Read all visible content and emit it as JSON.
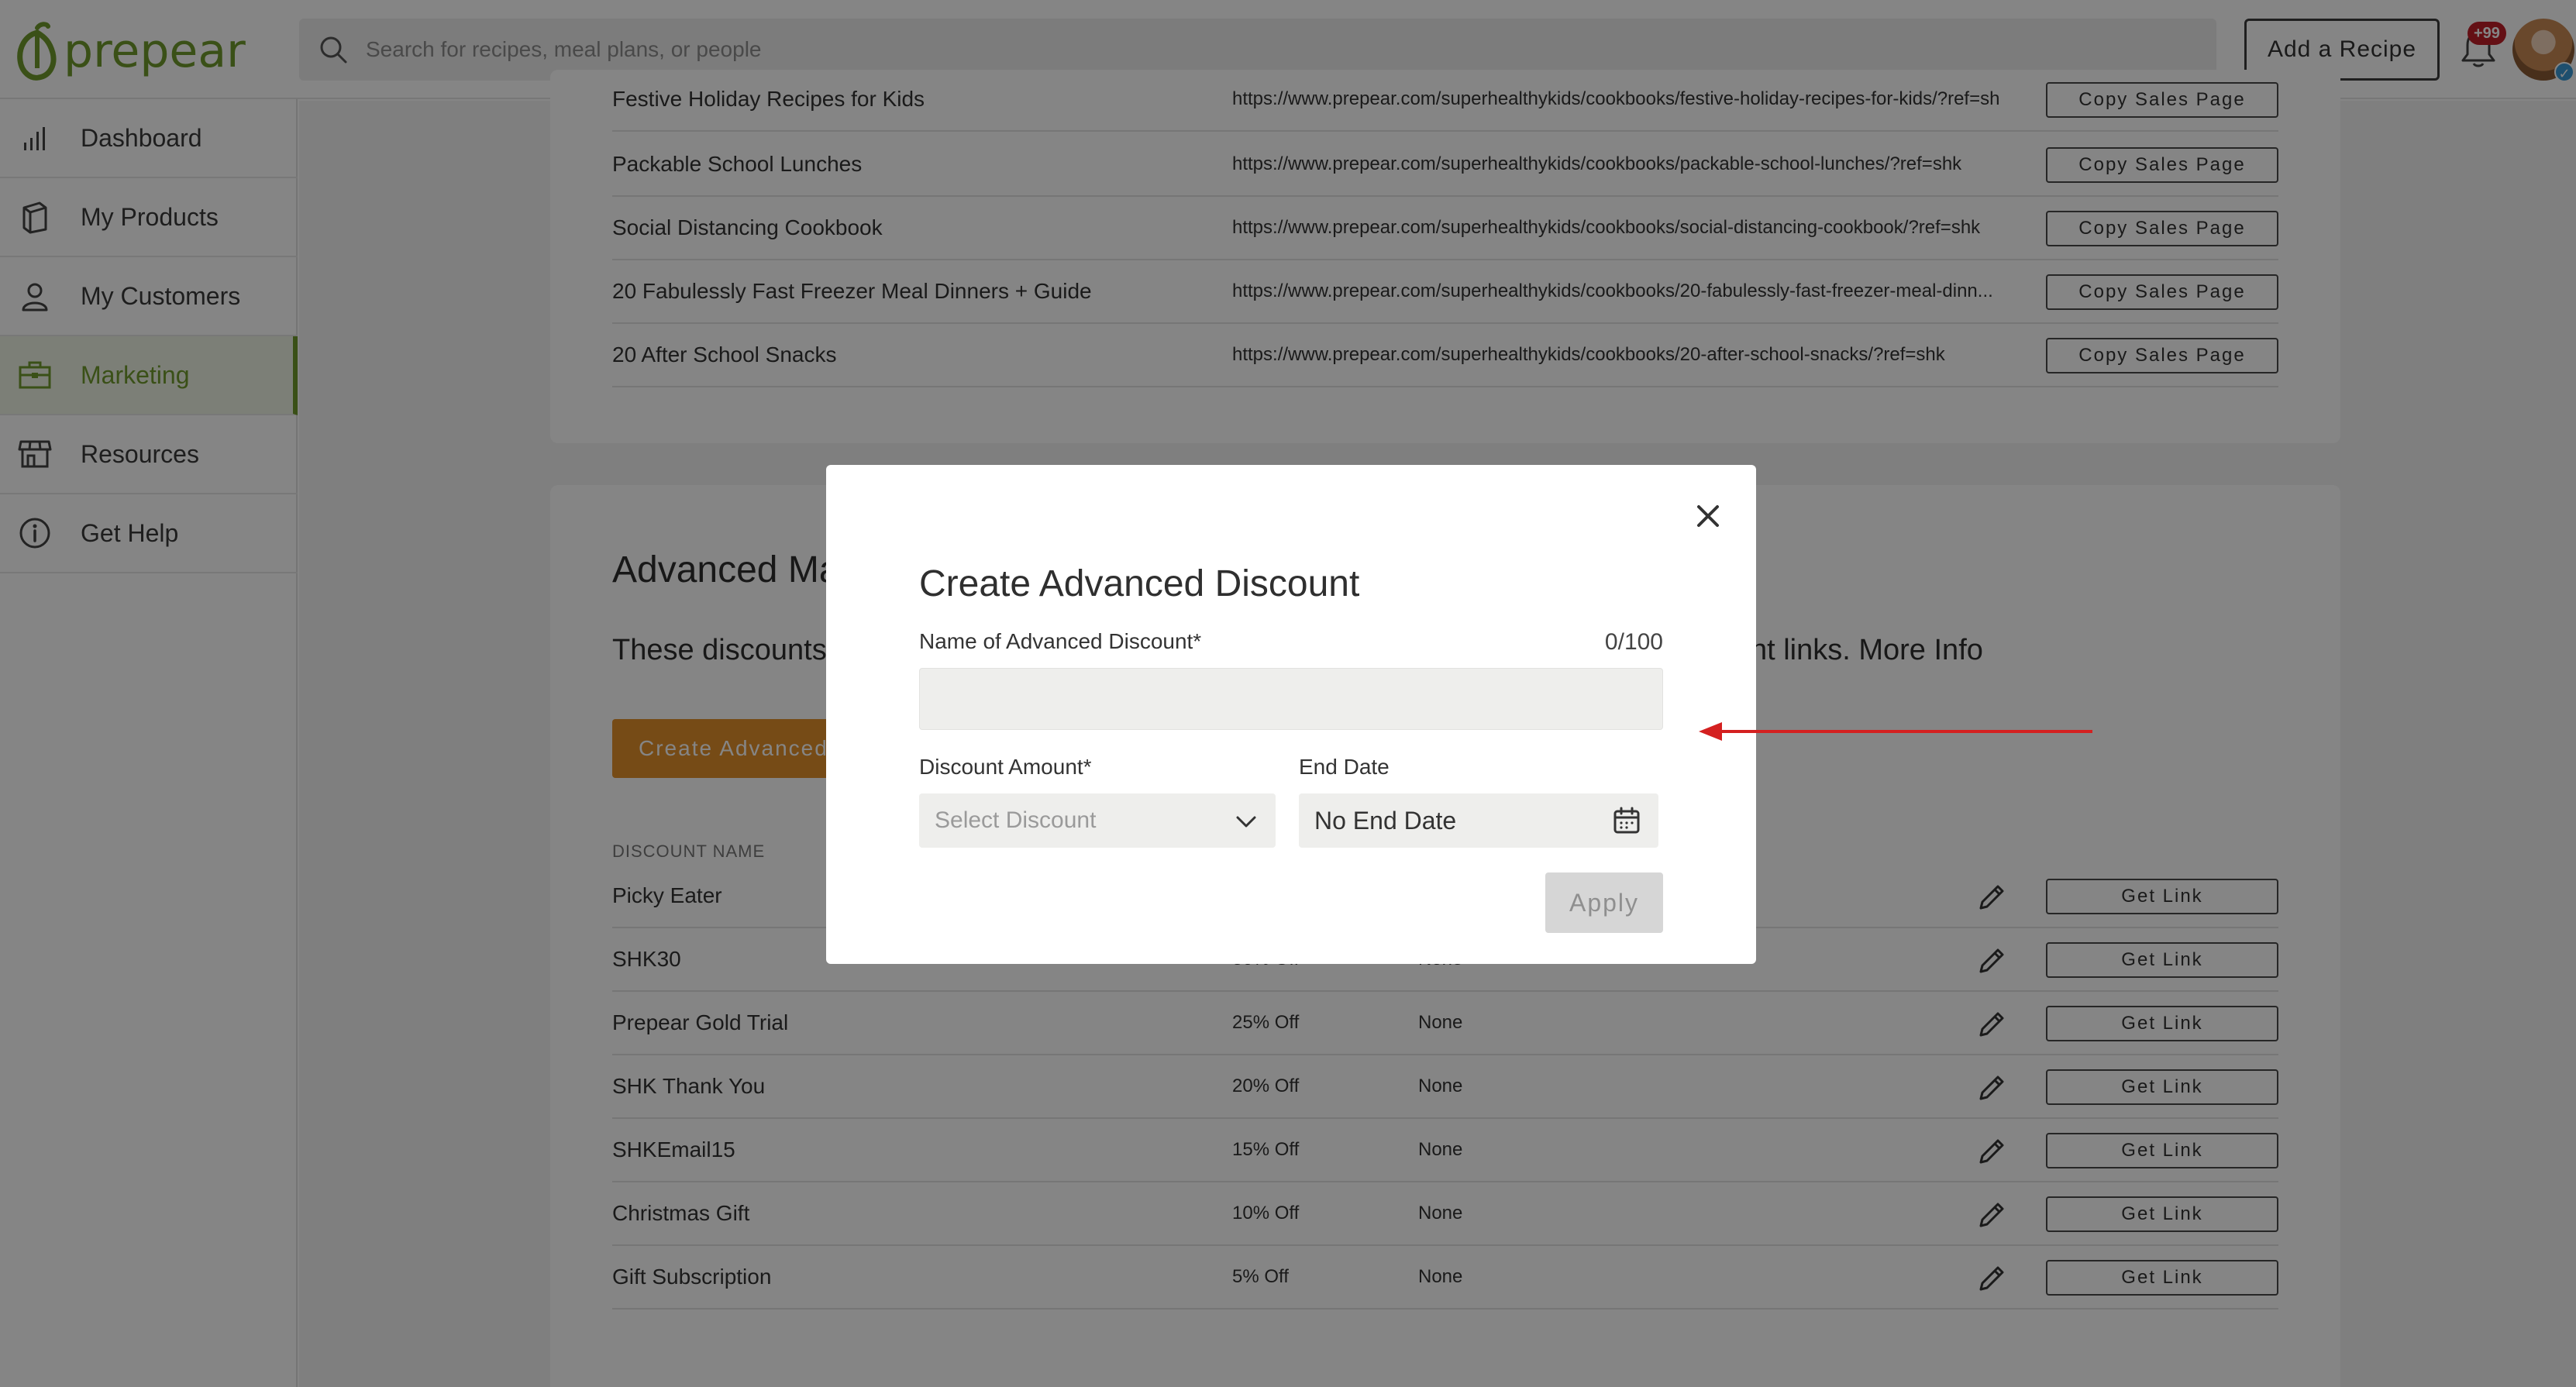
{
  "app": {
    "logo_text": "prepear",
    "brand_color": "#6f9a2c"
  },
  "header": {
    "search_placeholder": "Search for recipes, meal plans, or people",
    "add_recipe_label": "Add a Recipe",
    "notification_count": "+99"
  },
  "sidebar": {
    "items": [
      {
        "label": "Dashboard",
        "icon": "bar-chart-icon"
      },
      {
        "label": "My Products",
        "icon": "box-icon"
      },
      {
        "label": "My Customers",
        "icon": "person-icon"
      },
      {
        "label": "Marketing",
        "icon": "briefcase-icon",
        "active": true
      },
      {
        "label": "Resources",
        "icon": "storefront-icon"
      },
      {
        "label": "Get Help",
        "icon": "info-icon"
      }
    ]
  },
  "sales_pages": {
    "rows": [
      {
        "name": "Festive Holiday Recipes for Kids",
        "url": "https://www.prepear.com/superhealthykids/cookbooks/festive-holiday-recipes-for-kids/?ref=shk",
        "button": "Copy Sales Page"
      },
      {
        "name": "Packable School Lunches",
        "url": "https://www.prepear.com/superhealthykids/cookbooks/packable-school-lunches/?ref=shk",
        "button": "Copy Sales Page"
      },
      {
        "name": "Social Distancing Cookbook",
        "url": "https://www.prepear.com/superhealthykids/cookbooks/social-distancing-cookbook/?ref=shk",
        "button": "Copy Sales Page"
      },
      {
        "name": "20 Fabulessly Fast Freezer Meal Dinners + Guide",
        "url": "https://www.prepear.com/superhealthykids/cookbooks/20-fabulessly-fast-freezer-meal-dinn...",
        "button": "Copy Sales Page"
      },
      {
        "name": "20 After School Snacks",
        "url": "https://www.prepear.com/superhealthykids/cookbooks/20-after-school-snacks/?ref=shk",
        "button": "Copy Sales Page"
      }
    ]
  },
  "advanced": {
    "title": "Advanced Ma",
    "desc_left": "These discounts",
    "desc_right": "ount links. More Info",
    "create_button": "Create Advanced",
    "column_name": "DISCOUNT NAME",
    "rows": [
      {
        "name": "Picky Eater",
        "amount": "",
        "end": "",
        "button": "Get Link"
      },
      {
        "name": "SHK30",
        "amount": "30% Off",
        "end": "None",
        "button": "Get Link"
      },
      {
        "name": "Prepear Gold Trial",
        "amount": "25% Off",
        "end": "None",
        "button": "Get Link"
      },
      {
        "name": "SHK Thank You",
        "amount": "20% Off",
        "end": "None",
        "button": "Get Link"
      },
      {
        "name": "SHKEmail15",
        "amount": "15% Off",
        "end": "None",
        "button": "Get Link"
      },
      {
        "name": "Christmas Gift",
        "amount": "10% Off",
        "end": "None",
        "button": "Get Link"
      },
      {
        "name": "Gift Subscription",
        "amount": "5% Off",
        "end": "None",
        "button": "Get Link"
      }
    ]
  },
  "modal": {
    "title": "Create Advanced Discount",
    "name_label": "Name of Advanced Discount*",
    "char_count": "0/100",
    "name_value": "",
    "amount_label": "Discount Amount*",
    "amount_placeholder": "Select Discount",
    "end_label": "End Date",
    "end_value": "No End Date",
    "apply_label": "Apply"
  },
  "annotation": {
    "arrow_color": "#d42020"
  }
}
